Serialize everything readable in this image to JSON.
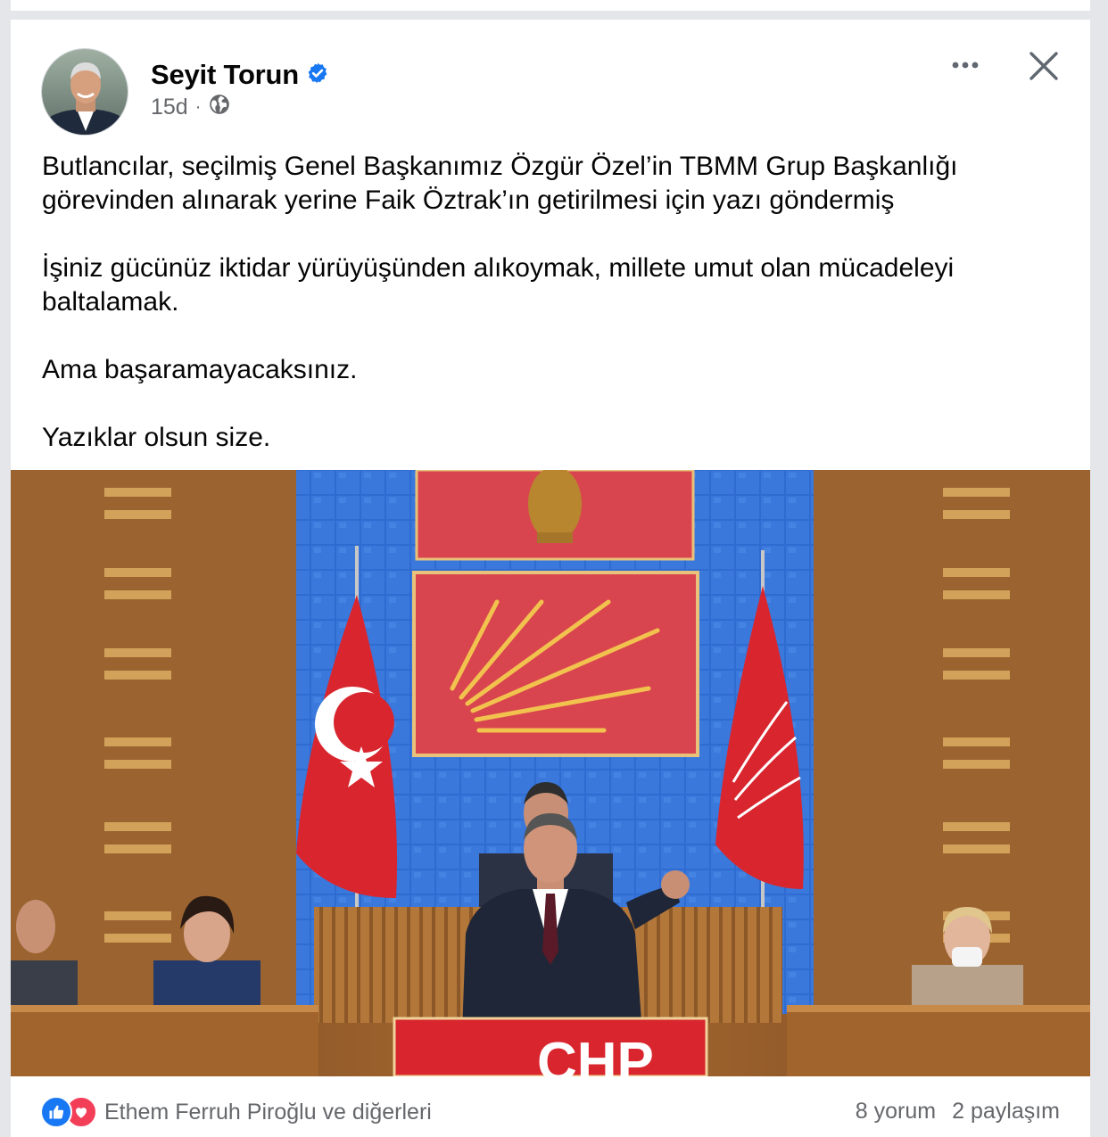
{
  "post": {
    "author_name": "Seyit Torun",
    "timestamp": "15d",
    "separator": "·",
    "audience_icon": "globe-icon",
    "verified_icon": "verified-badge-icon",
    "paragraphs": [
      "Butlancılar,  seçilmiş Genel Başkanımız Özgür Özel’in TBMM Grup Başkanlığı görevinden alınarak yerine Faik Öztrak’ın getirilmesi için yazı göndermiş",
      "İşiniz gücünüz iktidar yürüyüşünden alıkoymak, millete umut olan mücadeleyi baltalamak.",
      "Ama başaramayacaksınız.",
      "Yazıklar olsun size."
    ],
    "photo": {
      "podium_text": "CHP"
    }
  },
  "actions": {
    "more_icon": "more-options-icon",
    "close_icon": "close-icon"
  },
  "footer": {
    "reactors": "Ethem Ferruh Piroğlu ve diğerleri",
    "comments": "8 yorum",
    "shares": "2 paylaşım"
  },
  "colors": {
    "accent": "#1877f2",
    "love": "#f33e58",
    "secondary_text": "#65676b",
    "flag_red": "#d9262e"
  }
}
